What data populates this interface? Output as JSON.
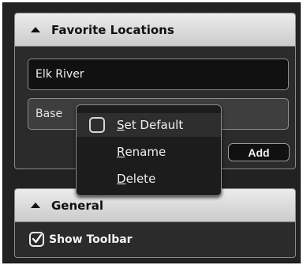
{
  "favorites": {
    "title": "Favorite Locations",
    "locations": [
      "Elk River",
      "Base"
    ],
    "add_label": "Add"
  },
  "context_menu": {
    "items": [
      {
        "first": "S",
        "rest": "et Default",
        "checked": false
      },
      {
        "first": "R",
        "rest": "ename"
      },
      {
        "first": "D",
        "rest": "elete"
      }
    ]
  },
  "general": {
    "title": "General",
    "show_toolbar_label": "Show Toolbar",
    "show_toolbar_checked": true
  },
  "icons": {
    "collapse": "triangle-up-icon",
    "check": "checkmark-icon"
  }
}
